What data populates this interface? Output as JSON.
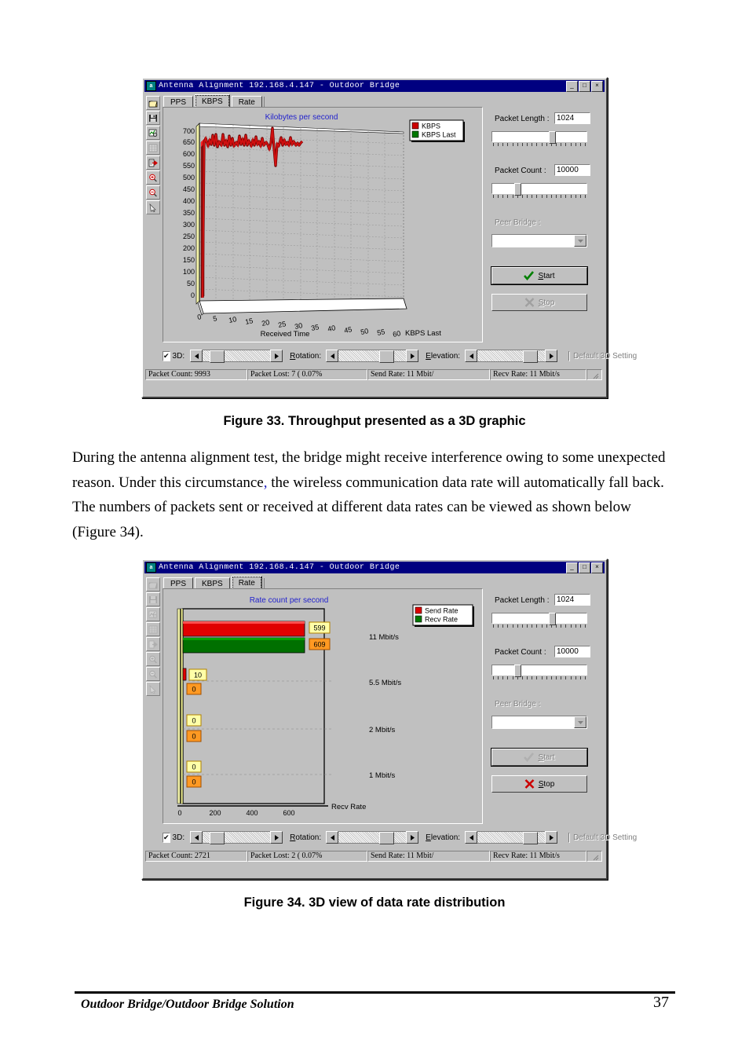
{
  "document": {
    "figure33_caption": "Figure 33.  Throughput presented as a 3D graphic",
    "paragraph_part1": "During the antenna alignment test, the bridge might receive interference owing to some unexpected reason. Under this circumstance",
    "paragraph_comma": ",",
    "paragraph_part2": " the wireless communication data rate will automatically fall back. The numbers of packets sent or received at different data rates can be viewed as shown below (Figure 34).",
    "figure34_caption": "Figure 34.  3D view of data rate distribution",
    "footer_left": "Outdoor Bridge/Outdoor Bridge Solution",
    "footer_page": "37"
  },
  "window1": {
    "title": "Antenna Alignment 192.168.4.147 - Outdoor Bridge",
    "app_icon": "antenna-icon",
    "minimize": "_",
    "maximize": "□",
    "close": "×",
    "tabs": [
      {
        "label": "PPS",
        "selected": false
      },
      {
        "label": "KBPS",
        "selected": true
      },
      {
        "label": "Rate",
        "selected": false
      }
    ],
    "toolbar": [
      {
        "icon": "open-folder-icon",
        "disabled": false
      },
      {
        "icon": "save-disk-icon",
        "disabled": false
      },
      {
        "icon": "copy-chart-icon",
        "disabled": false
      },
      {
        "icon": "grid-table-icon",
        "disabled": true
      },
      {
        "icon": "export-arrow-icon",
        "disabled": false
      },
      {
        "icon": "zoom-in-icon",
        "disabled": false
      },
      {
        "icon": "zoom-out-icon",
        "disabled": false
      },
      {
        "icon": "pointer-tool-icon",
        "disabled": false
      }
    ],
    "controls": {
      "packet_length_label": "Packet Length :",
      "packet_length_value": "1024",
      "packet_count_label": "Packet Count :",
      "packet_count_value": "10000",
      "peer_bridge_label": "Peer Bridge :",
      "peer_bridge_value": "",
      "peer_bridge_disabled": true,
      "start_label": "Start",
      "start_disabled": false,
      "stop_label": "Stop",
      "stop_disabled": true,
      "length_slider_pct": 62,
      "count_slider_pct": 17
    },
    "bottombar": {
      "three_d_label": "3D:",
      "three_d_checked": true,
      "three_d_check_glyph": "✔",
      "rotation_label": "Rotation:",
      "elevation_label": "Elevation:",
      "default_label": "Default 3D Setting",
      "default_checked": false,
      "depth_thumb_pct": 10,
      "rotation_thumb_pct": 68,
      "elevation_thumb_pct": 74
    },
    "status": [
      "Packet Count: 9993",
      "Packet Lost: 7 ( 0.07%",
      "Send Rate: 11 Mbit/",
      "Recv Rate: 11 Mbit/s"
    ]
  },
  "window2": {
    "title": "Antenna Alignment 192.168.4.147 - Outdoor Bridge",
    "app_icon": "antenna-icon",
    "minimize": "_",
    "maximize": "□",
    "close": "×",
    "tabs": [
      {
        "label": "PPS",
        "selected": false
      },
      {
        "label": "KBPS",
        "selected": false
      },
      {
        "label": "Rate",
        "selected": true
      }
    ],
    "toolbar": [
      {
        "icon": "open-folder-icon",
        "disabled": true
      },
      {
        "icon": "save-disk-icon",
        "disabled": true
      },
      {
        "icon": "copy-chart-icon",
        "disabled": true
      },
      {
        "icon": "grid-table-icon",
        "disabled": true
      },
      {
        "icon": "export-arrow-icon",
        "disabled": true
      },
      {
        "icon": "zoom-in-icon",
        "disabled": true
      },
      {
        "icon": "zoom-out-icon",
        "disabled": true
      },
      {
        "icon": "pointer-tool-icon",
        "disabled": true
      }
    ],
    "controls": {
      "packet_length_label": "Packet Length :",
      "packet_length_value": "1024",
      "packet_count_label": "Packet Count :",
      "packet_count_value": "10000",
      "peer_bridge_label": "Peer Bridge :",
      "peer_bridge_value": "",
      "peer_bridge_disabled": true,
      "start_label": "Start",
      "start_disabled": true,
      "stop_label": "Stop",
      "stop_disabled": false,
      "length_slider_pct": 62,
      "count_slider_pct": 17
    },
    "bottombar": {
      "three_d_label": "3D:",
      "three_d_checked": true,
      "three_d_check_glyph": "✔",
      "rotation_label": "Rotation:",
      "elevation_label": "Elevation:",
      "default_label": "Default 3D Setting",
      "default_checked": false,
      "depth_thumb_pct": 10,
      "rotation_thumb_pct": 68,
      "elevation_thumb_pct": 74
    },
    "status": [
      "Packet Count: 2721",
      "Packet Lost: 2 ( 0.07%",
      "Send Rate: 11 Mbit/",
      "Recv Rate: 11 Mbit/s"
    ]
  },
  "chart_data": [
    {
      "type": "line",
      "title": "Kilobytes per second",
      "title_color": "#2222cc",
      "xlabel": "Received Time",
      "ylabel": "",
      "zlabel": "KBPS Last",
      "grid": true,
      "three_d": true,
      "legend_position": "top-right",
      "legend": [
        {
          "name": "KBPS",
          "color": "#cc0000"
        },
        {
          "name": "KBPS Last",
          "color": "#007700"
        }
      ],
      "xticks": [
        0,
        5,
        10,
        15,
        20,
        25,
        30,
        35,
        40,
        45,
        50,
        55,
        60
      ],
      "yticks": [
        0,
        50,
        100,
        150,
        200,
        250,
        300,
        350,
        400,
        450,
        500,
        550,
        600,
        650,
        700
      ],
      "xlim": [
        0,
        60
      ],
      "ylim": [
        0,
        730
      ],
      "series": [
        {
          "name": "KBPS",
          "color": "#cc0000",
          "x": [
            0.4,
            0.9,
            1.4,
            1.9,
            2.4,
            2.9,
            3.4,
            3.9,
            4.4,
            4.9,
            5.4,
            5.9,
            6.4,
            6.9,
            7.4,
            7.9,
            8.4,
            8.9,
            9.4,
            9.9,
            10.4,
            10.9,
            11.4,
            11.9,
            12.4,
            12.9,
            13.4,
            13.9,
            14.4,
            14.9,
            15.4,
            15.9,
            16.4,
            16.9,
            17.4,
            17.9,
            18.4,
            18.9,
            19.4,
            19.9,
            20.4,
            20.9,
            21.4,
            21.9,
            22.4,
            22.9,
            23.4,
            23.9,
            24.4,
            24.9,
            25.4,
            25.9,
            26.4,
            26.9,
            27.4,
            27.9,
            28.4,
            28.9,
            29.4,
            29.9,
            30.4
          ],
          "y": [
            12,
            648,
            672,
            630,
            662,
            640,
            688,
            636,
            690,
            624,
            652,
            632,
            690,
            636,
            658,
            628,
            684,
            632,
            672,
            628,
            648,
            630,
            684,
            640,
            666,
            630,
            686,
            632,
            660,
            626,
            664,
            628,
            680,
            636,
            652,
            624,
            676,
            630,
            648,
            640,
            618,
            652,
            714,
            620,
            538,
            646,
            634,
            678,
            624,
            666,
            630,
            654,
            620,
            676,
            630,
            644,
            616,
            650,
            628,
            640,
            652
          ]
        },
        {
          "name": "KBPS Last",
          "color": "#007700",
          "x": [],
          "y": []
        }
      ]
    },
    {
      "type": "bar",
      "orientation": "horizontal",
      "title": "Rate count per second",
      "title_color": "#2222cc",
      "xlabel": "Recv Rate",
      "ylabel": "",
      "grid": true,
      "three_d": true,
      "legend_position": "top-right",
      "legend": [
        {
          "name": "Send Rate",
          "color": "#dd0000"
        },
        {
          "name": "Recv Rate",
          "color": "#007700"
        }
      ],
      "categories": [
        "11 Mbit/s",
        "5.5 Mbit/s",
        "2 Mbit/s",
        "1 Mbit/s"
      ],
      "xticks": [
        0,
        200,
        400,
        600
      ],
      "xlim": [
        0,
        700
      ],
      "series": [
        {
          "name": "Send Rate",
          "color": "#dd0000",
          "label_bg": "#ffffaa",
          "values": [
            599,
            10,
            0,
            0
          ],
          "labels": [
            "599",
            "10",
            "0",
            "0"
          ]
        },
        {
          "name": "Recv Rate",
          "color": "#007700",
          "label_bg": "#ff9922",
          "values": [
            609,
            0,
            0,
            0
          ],
          "labels": [
            "609",
            "0",
            "0",
            "0"
          ]
        }
      ]
    }
  ]
}
